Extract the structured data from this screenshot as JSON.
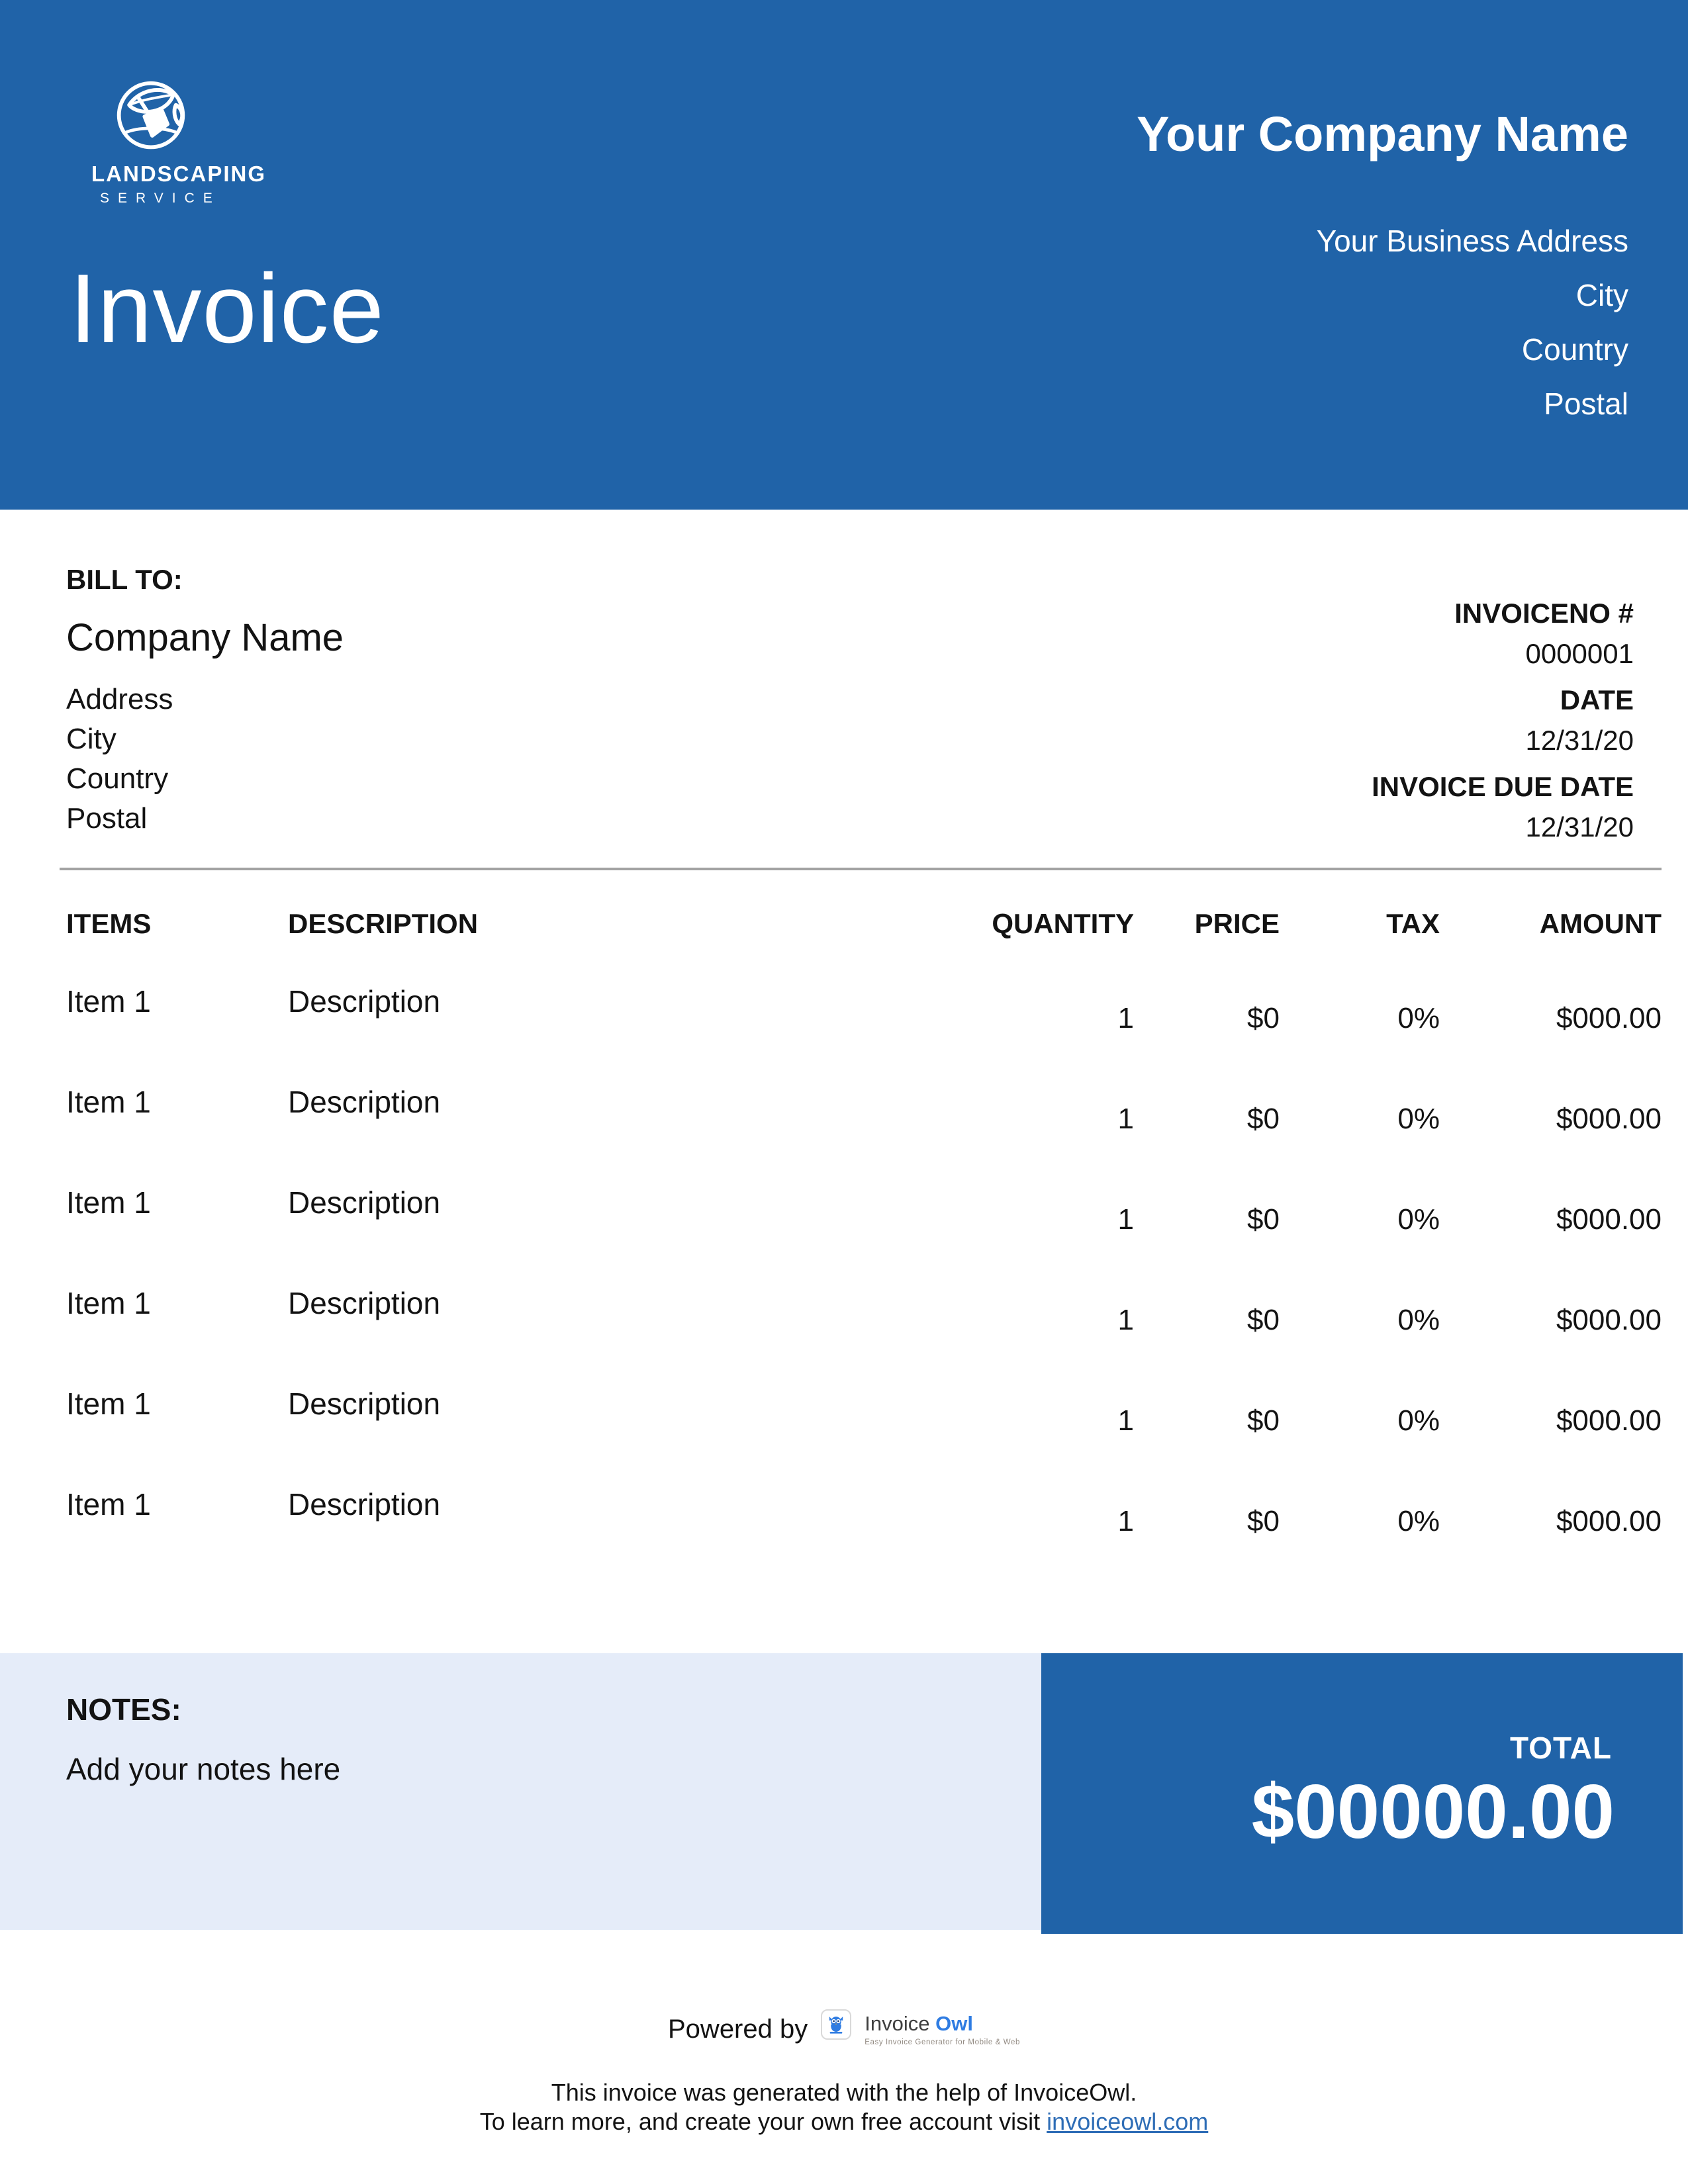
{
  "header": {
    "logo": {
      "name": "LANDSCAPING",
      "sub": "SERVICE"
    },
    "title": "Invoice",
    "company_name": "Your Company Name",
    "address_lines": [
      "Your Business Address",
      "City",
      "Country",
      "Postal"
    ]
  },
  "bill_to": {
    "label": "BILL TO:",
    "company": "Company Name",
    "lines": [
      "Address",
      "City",
      "Country",
      "Postal"
    ]
  },
  "invoice_info": [
    {
      "label": "INVOICENO #",
      "value": "0000001"
    },
    {
      "label": "DATE",
      "value": "12/31/20"
    },
    {
      "label": "INVOICE DUE DATE",
      "value": "12/31/20"
    }
  ],
  "table": {
    "headers": [
      "ITEMS",
      "DESCRIPTION",
      "QUANTITY",
      "PRICE",
      "TAX",
      "AMOUNT"
    ],
    "rows": [
      {
        "item": "Item 1",
        "description": "Description",
        "quantity": "1",
        "price": "$0",
        "tax": "0%",
        "amount": "$000.00"
      },
      {
        "item": "Item 1",
        "description": "Description",
        "quantity": "1",
        "price": "$0",
        "tax": "0%",
        "amount": "$000.00"
      },
      {
        "item": "Item 1",
        "description": "Description",
        "quantity": "1",
        "price": "$0",
        "tax": "0%",
        "amount": "$000.00"
      },
      {
        "item": "Item 1",
        "description": "Description",
        "quantity": "1",
        "price": "$0",
        "tax": "0%",
        "amount": "$000.00"
      },
      {
        "item": "Item 1",
        "description": "Description",
        "quantity": "1",
        "price": "$0",
        "tax": "0%",
        "amount": "$000.00"
      },
      {
        "item": "Item 1",
        "description": "Description",
        "quantity": "1",
        "price": "$0",
        "tax": "0%",
        "amount": "$000.00"
      }
    ]
  },
  "notes": {
    "label": "NOTES:",
    "text": "Add your notes here"
  },
  "total": {
    "label": "TOTAL",
    "amount": "$00000.00"
  },
  "footer": {
    "powered_by": "Powered by",
    "logo": {
      "wordmark_1": "Invoice",
      "wordmark_2": "Owl",
      "tagline": "Easy Invoice Generator for Mobile & Web"
    },
    "line1": "This invoice was generated with the help of InvoiceOwl.",
    "line2_prefix": "To learn more, and create your own free account visit ",
    "link": "invoiceowl.com"
  },
  "colors": {
    "header_blue": "#2063a8",
    "notes_background": "#e5ecf9",
    "link_blue": "#2e6db6",
    "owl_blue": "#2f7ce2"
  }
}
